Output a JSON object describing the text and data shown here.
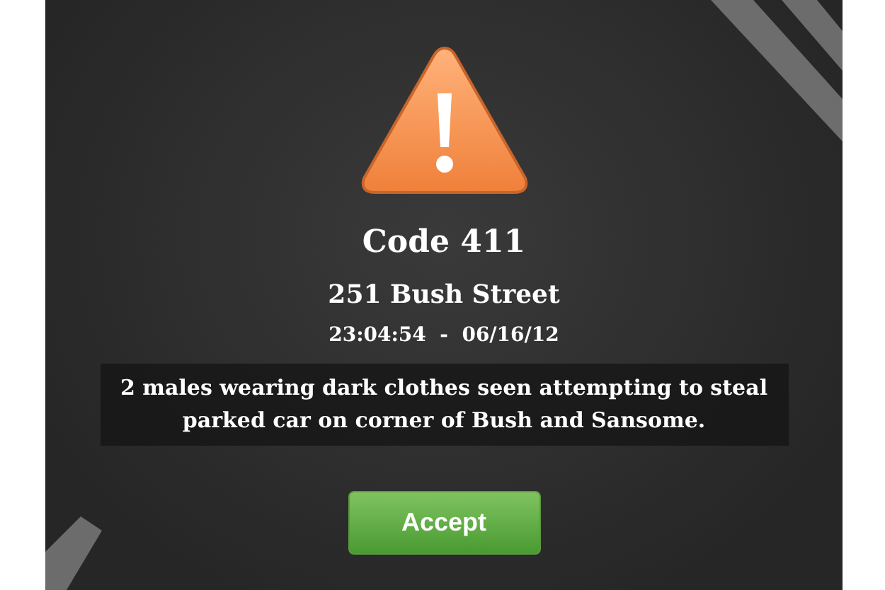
{
  "alert": {
    "title": "Code 411",
    "address": "251 Bush Street",
    "timestamp": "23:04:54  -  06/16/12",
    "description": "2 males wearing dark clothes seen attempting to steal parked car on corner of Bush and Sansome.",
    "button": "Accept"
  }
}
